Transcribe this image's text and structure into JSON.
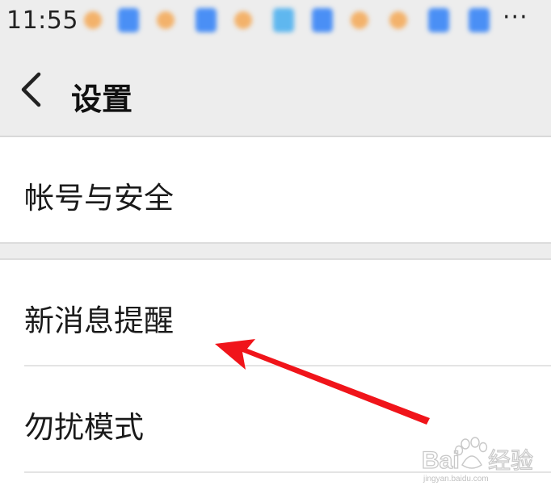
{
  "status_bar": {
    "time": "11:55",
    "more": "···",
    "notification_colors": [
      "#f3b26b",
      "#4a8ff5",
      "#f3b26b",
      "#4a8ff5",
      "#f3b26b",
      "#5fb7ef",
      "#4a8ff5",
      "#f3b26b",
      "#f3b26b",
      "#4a8ff5",
      "#4a8ff5"
    ]
  },
  "nav": {
    "back_icon": "chevron-left-icon",
    "title": "设置"
  },
  "settings": {
    "items": [
      {
        "label": "帐号与安全"
      },
      {
        "label": "新消息提醒"
      },
      {
        "label": "勿扰模式"
      }
    ]
  },
  "annotation": {
    "arrow_color": "#f0141a",
    "target": "新消息提醒"
  },
  "watermark": {
    "brand": "Bai",
    "brand_suffix": "经验",
    "site": "jingyan.baidu.com"
  },
  "colors": {
    "background": "#ededed",
    "card": "#ffffff",
    "text": "#1a1a1a"
  }
}
